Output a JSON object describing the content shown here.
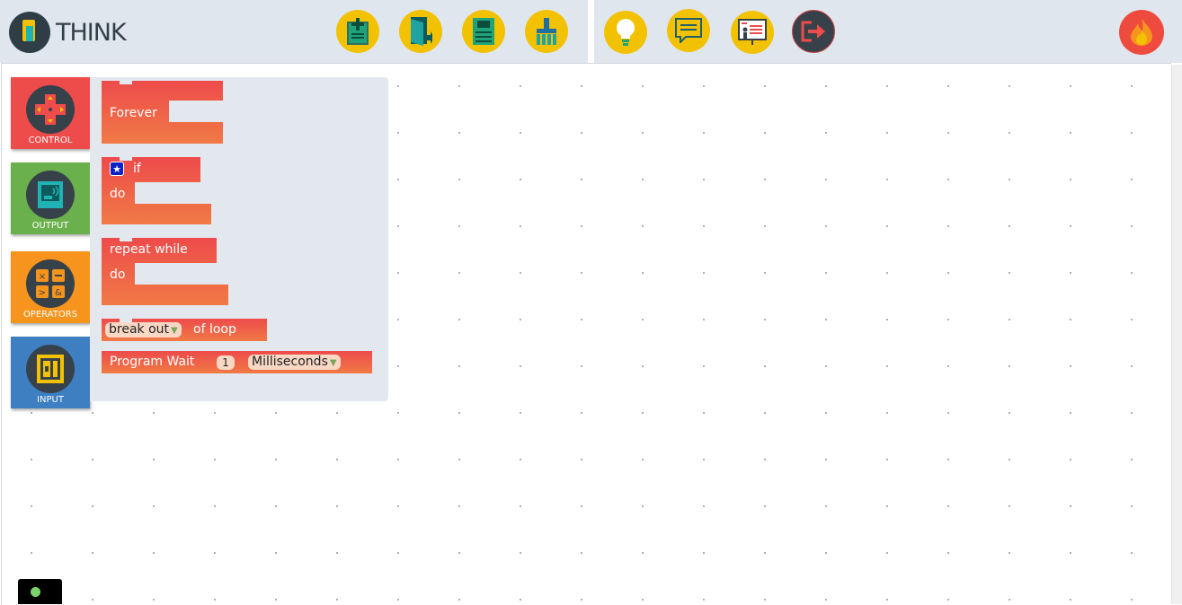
{
  "app": {
    "title": "THINK"
  },
  "toolbar": {
    "new_label": "new-file",
    "open_label": "open",
    "save_label": "save",
    "clear_label": "clear",
    "tips_label": "tips",
    "chat_label": "chat",
    "present_label": "presentation",
    "exit_label": "exit"
  },
  "categories": [
    {
      "label": "CONTROL",
      "color": "#ee4b4b"
    },
    {
      "label": "OUTPUT",
      "color": "#6ab04c"
    },
    {
      "label": "OPERATORS",
      "color": "#f7941d"
    },
    {
      "label": "INPUT",
      "color": "#3d7fc1"
    }
  ],
  "blocks": {
    "forever": "Forever",
    "if_label": "if",
    "if_do": "do",
    "repeat_while": "repeat while",
    "repeat_do": "do",
    "break_option": "break out",
    "break_suffix": "of loop",
    "wait_label": "Program Wait",
    "wait_value": "1",
    "wait_unit": "Milliseconds"
  }
}
